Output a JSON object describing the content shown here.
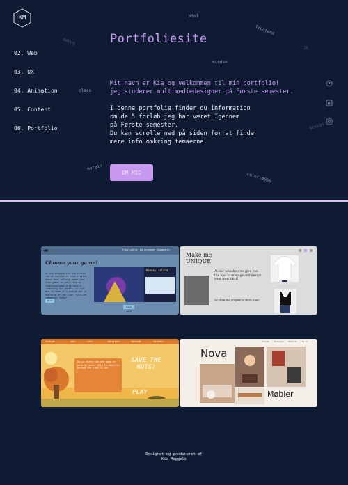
{
  "logo": {
    "initials": "KM"
  },
  "nav": [
    {
      "label": "02. Web"
    },
    {
      "label": "03. UX"
    },
    {
      "label": "04. Animation"
    },
    {
      "label": "05. Content"
    },
    {
      "label": "06. Portfolio"
    }
  ],
  "hero": {
    "title": "Portfoliesite",
    "intro": "Mit navn er Kia og velkommen til min portfolio!\njeg studerer multimediedesigner på Første semester.",
    "body": "I denne portfolie finder du information\nom de 5 forløb jeg har været Igennem\npå Første semester.\nDu kan scrolle ned på siden for at finde\nmere info omkring temaerne.",
    "button": "OM MIG"
  },
  "floaters": {
    "html": "html",
    "frontend": "frontend",
    "debug": "debug",
    "js": "JS",
    "code": "<code>",
    "class": "class",
    "design": "design",
    "margin": "margin",
    "color": "color:#000"
  },
  "projects": [
    {
      "name": "Web",
      "nav": [
        "Find udfra",
        "Om gruppen",
        "Community"
      ],
      "heading": "Choose your game!",
      "blurb": "At our webpage you and others can do reviews or read reviews about best selling games and free games as well! Kia at Chooseyourgame also have a community for gamers. If you are in need of a gaming pal or anything of the like, join our community today!",
      "badge": "Monkey Island",
      "button_1": "Read",
      "button_2": "Read more"
    },
    {
      "name": "UX",
      "heading": "Make me UNIQUE",
      "text": "At our webshop we give you the tool to manage and design your own shirt!",
      "cta": "Go to our DIY program to check it out!"
    },
    {
      "name": "Animation",
      "nav": [
        "Forside",
        "Spil",
        "Info",
        "Aktiviter",
        "Kalende",
        "Kontakt"
      ],
      "speech": "Hello there! We are need of help my nuts! Help to squirrel before the time is up!",
      "headline": "SAVE THE NUTS!",
      "play": "PLAY"
    },
    {
      "name": "Content",
      "nav": [
        "Forside",
        "Produkter",
        "Historie",
        "Om os"
      ],
      "brand_1": "Nova",
      "brand_2": "Møbler"
    }
  ],
  "footer": {
    "line_1": "Designet og produceret af",
    "line_2": "Kia Meggele"
  },
  "colors": {
    "background": "#0f1a33",
    "accent": "#c59cf0",
    "button": "#c898ef",
    "divider": "#d9c7f5"
  }
}
